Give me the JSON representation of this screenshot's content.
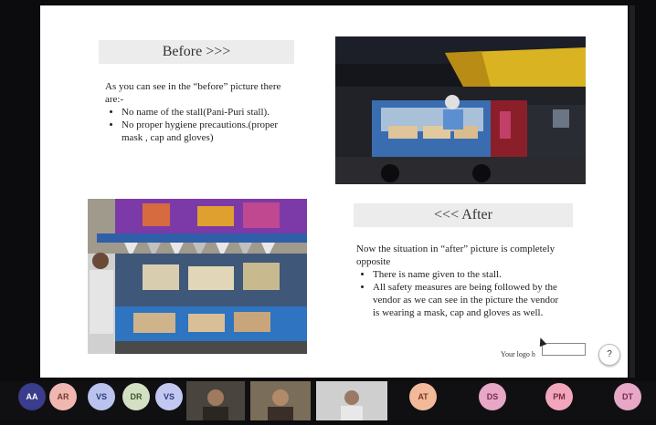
{
  "slide": {
    "before": {
      "heading": "Before >>>",
      "intro": "As you can see in the “before” picture there are:-",
      "bullets": [
        "No name of the stall(Pani-Puri stall).",
        "No proper hygiene precautions.(proper mask , cap and gloves)"
      ]
    },
    "after": {
      "heading": "<<< After",
      "intro": "Now the situation in “after” picture is completely opposite",
      "bullets": [
        "There is name given to the stall.",
        "All safety measures are being followed by the vendor as we can see in the picture the vendor is wearing a mask, cap and gloves as well."
      ]
    },
    "footer": "Your logo h",
    "help_label": "?"
  },
  "tooltip": "",
  "participants": [
    {
      "initials": "AA",
      "color": "#3a3c8c"
    },
    {
      "initials": "AR",
      "color": "#f0b7b0"
    },
    {
      "initials": "VS",
      "color": "#b9c3ee"
    },
    {
      "initials": "DR",
      "color": "#d3e0c4"
    },
    {
      "initials": "VS",
      "color": "#c3c8f0"
    },
    {
      "initials": "AT",
      "color": "#f2b99a"
    },
    {
      "initials": "DS",
      "color": "#e7a7c6"
    },
    {
      "initials": "PM",
      "color": "#f1a6bd"
    },
    {
      "initials": "DT",
      "color": "#e7a7c6"
    }
  ]
}
